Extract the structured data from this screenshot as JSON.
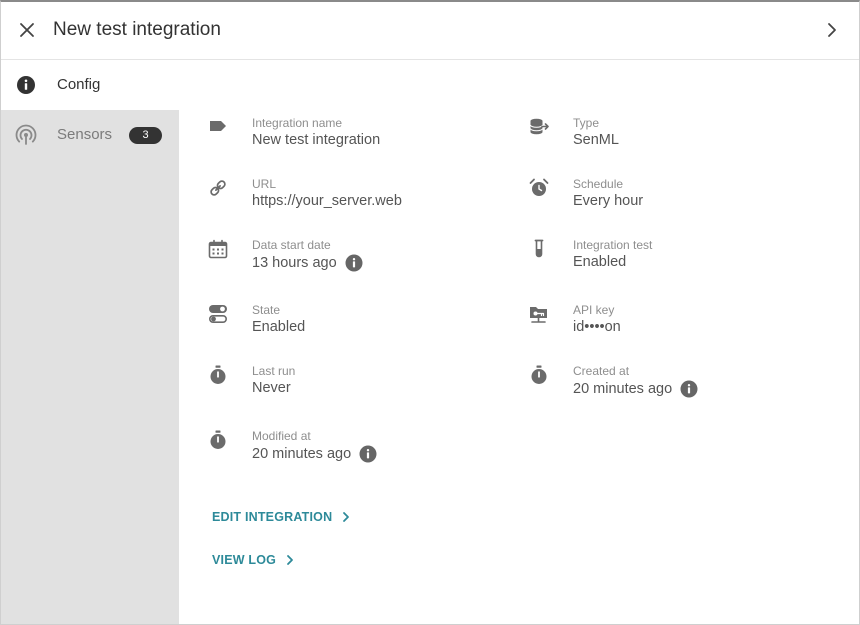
{
  "header": {
    "title": "New test integration"
  },
  "sidebar": {
    "items": [
      {
        "label": "Config",
        "icon": "info-circle-icon",
        "active": true
      },
      {
        "label": "Sensors",
        "icon": "sensor-signal-icon",
        "active": false,
        "badge": "3"
      }
    ]
  },
  "fields": {
    "integration_name": {
      "label": "Integration name",
      "value": "New test integration",
      "icon": "tag-icon"
    },
    "type": {
      "label": "Type",
      "value": "SenML",
      "icon": "database-arrow-icon"
    },
    "url": {
      "label": "URL",
      "value": "https://your_server.web",
      "icon": "link-icon"
    },
    "schedule": {
      "label": "Schedule",
      "value": "Every hour",
      "icon": "alarm-clock-icon"
    },
    "data_start_date": {
      "label": "Data start date",
      "value": "13 hours ago",
      "icon": "calendar-icon"
    },
    "integration_test": {
      "label": "Integration test",
      "value": "Enabled",
      "icon": "test-tube-icon"
    },
    "state": {
      "label": "State",
      "value": "Enabled",
      "icon": "toggle-icon"
    },
    "api_key": {
      "label": "API key",
      "value": "id••••on",
      "icon": "key-folder-icon"
    },
    "last_run": {
      "label": "Last run",
      "value": "Never",
      "icon": "stopwatch-icon"
    },
    "created_at": {
      "label": "Created at",
      "value": "20 minutes ago",
      "icon": "stopwatch-icon"
    },
    "modified_at": {
      "label": "Modified at",
      "value": "20 minutes ago",
      "icon": "stopwatch-icon"
    }
  },
  "actions": {
    "edit_label": "EDIT INTEGRATION",
    "view_log_label": "VIEW LOG"
  },
  "colors": {
    "accent": "#2d8a99",
    "sidebar_bg": "#e1e1e1",
    "badge_bg": "#333333",
    "icon": "#6b6b6b"
  }
}
